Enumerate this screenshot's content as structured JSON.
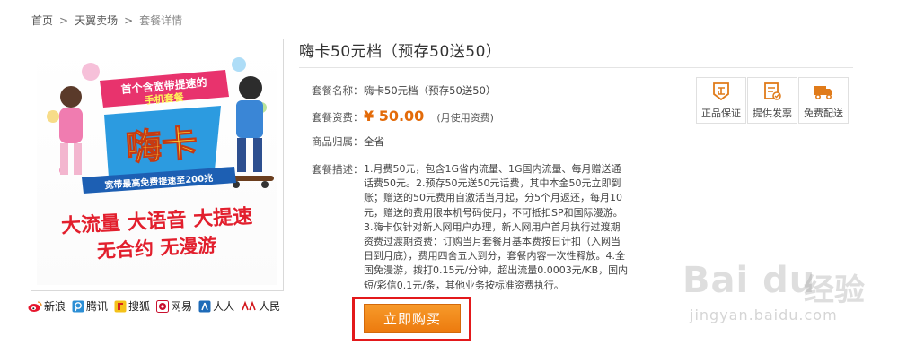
{
  "breadcrumb": {
    "home": "首页",
    "section": "天翼卖场",
    "current": "套餐详情",
    "separator": ">"
  },
  "product": {
    "title": "嗨卡50元档（预存50送50）",
    "name_label": "套餐名称：",
    "name_value": "嗨卡50元档（预存50送50）",
    "fee_label": "套餐资费：",
    "price": "¥ 50.00",
    "price_note": "(月使用资费)",
    "region_label": "商品归属：",
    "region_value": "全省",
    "desc_label": "套餐描述：",
    "desc_value": "1.月费50元，包含1G省内流量、1G国内流量、每月赠送通话费50元。2.预存50元送50元话费，其中本金50元立即到账；赠送的50元费用自激活当月起，分5个月返还，每月10元，赠送的费用限本机号码使用，不可抵扣SP和国际漫游。3.嗨卡仅针对新入网用户办理，新入网用户首月执行过渡期资费过渡期资费：订购当月套餐月基本费按日计扣（入网当日到月底），费用四舍五入到分，套餐内容一次性释放。4.全国免漫游，拨打0.15元/分钟，超出流量0.0003元/KB，国内短/彩信0.1元/条，其他业务按标准资费执行。"
  },
  "badges": [
    {
      "label": "正品保证",
      "icon": "genuine-icon"
    },
    {
      "label": "提供发票",
      "icon": "invoice-icon"
    },
    {
      "label": "免费配送",
      "icon": "delivery-icon"
    }
  ],
  "buy_button": {
    "label": "立即购买"
  },
  "share": [
    {
      "label": "新浪",
      "icon": "weibo-icon"
    },
    {
      "label": "腾讯",
      "icon": "tencent-icon"
    },
    {
      "label": "搜狐",
      "icon": "sohu-icon"
    },
    {
      "label": "网易",
      "icon": "netease-icon"
    },
    {
      "label": "人人",
      "icon": "renren-icon"
    },
    {
      "label": "人民",
      "icon": "people-icon"
    }
  ],
  "banner": {
    "headline_1": "首个含宽带提速的",
    "headline_2": "手机套餐",
    "brand": "嗨卡",
    "sub": "宽带最高免费提速至200兆",
    "slogan_1": "大流量 大语音 大提速",
    "slogan_2": "无合约 无漫游"
  },
  "watermark": {
    "logo": "Bai du",
    "cn": "经验",
    "url": "jingyan.baidu.com"
  },
  "colors": {
    "accent": "#ec7a0e",
    "price": "#e36b0a",
    "highlight_frame": "#e3191b",
    "badge_icon": "#e07b1a"
  }
}
